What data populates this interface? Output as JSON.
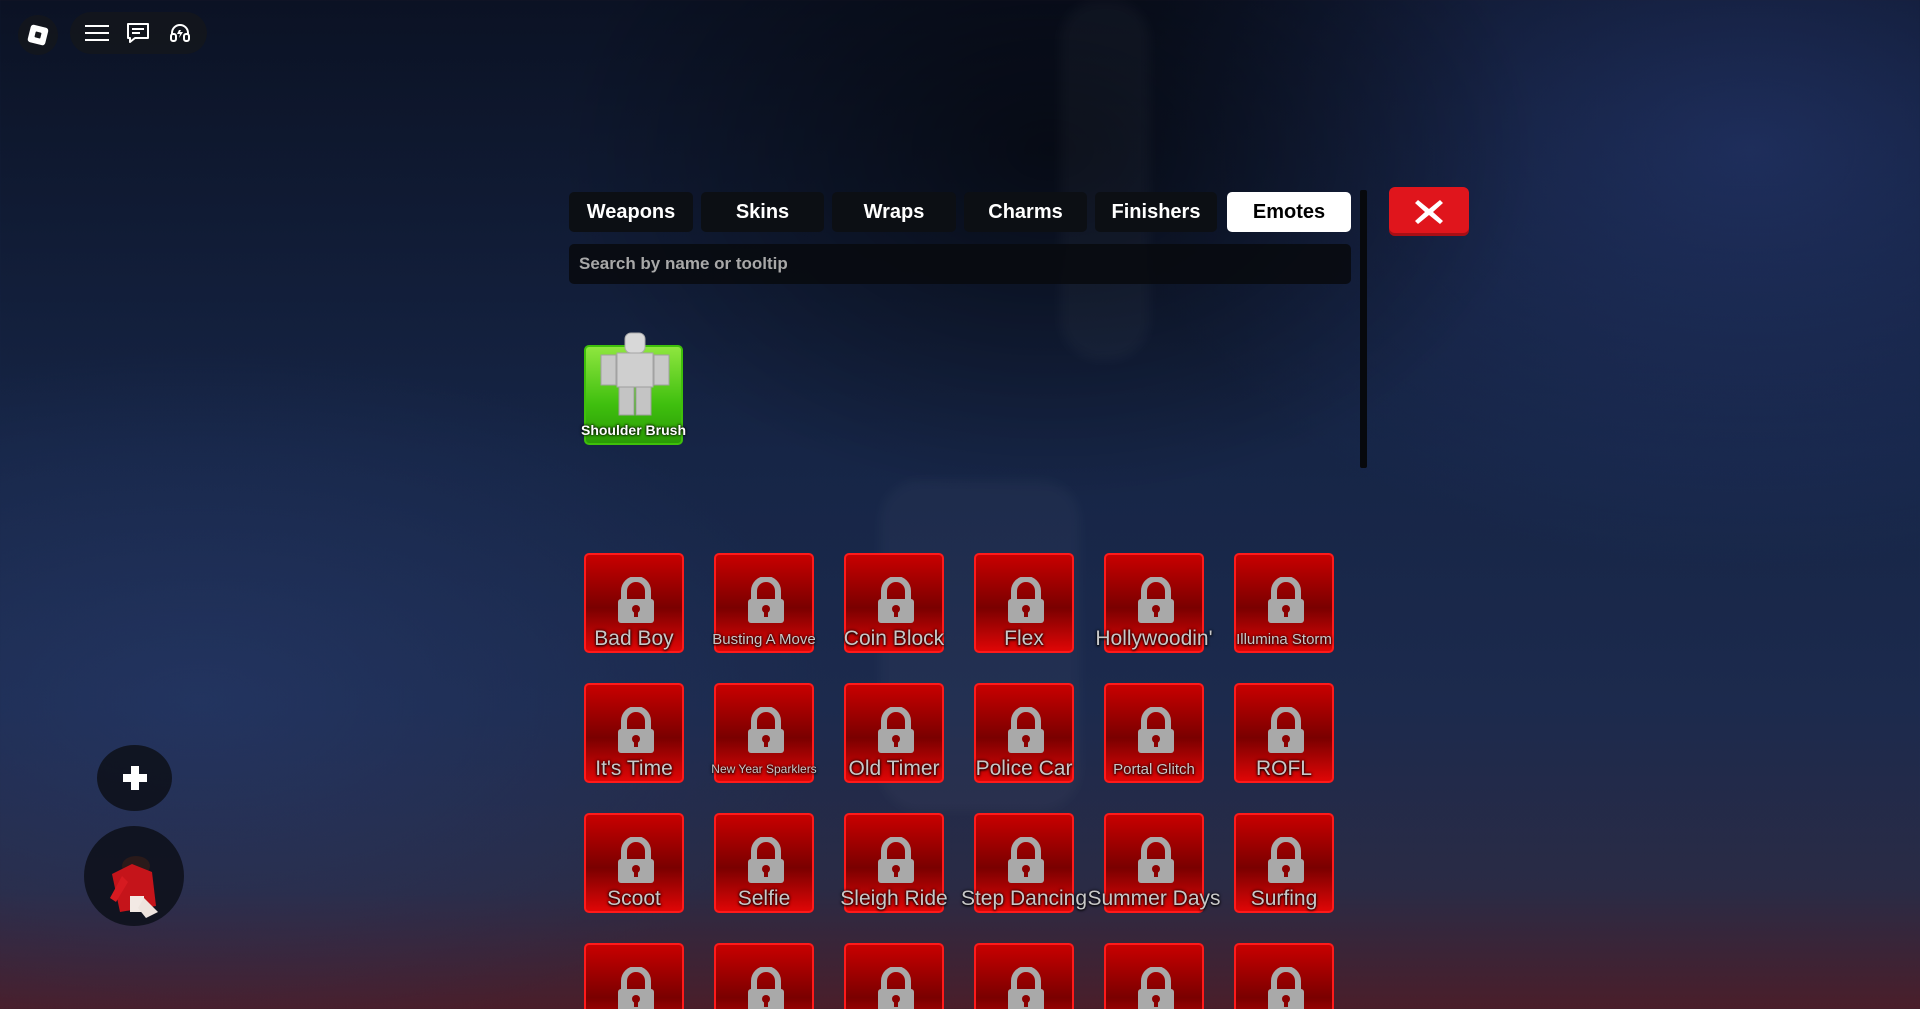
{
  "topbar": {
    "logo_icon": "roblox-logo-icon",
    "menu_icon": "hamburger-menu-icon",
    "chat_icon": "chat-icon",
    "headset_icon": "voice-headset-icon"
  },
  "tabs": [
    {
      "label": "Weapons",
      "active": false
    },
    {
      "label": "Skins",
      "active": false
    },
    {
      "label": "Wraps",
      "active": false
    },
    {
      "label": "Charms",
      "active": false
    },
    {
      "label": "Finishers",
      "active": false
    },
    {
      "label": "Emotes",
      "active": true
    }
  ],
  "close_icon": "close-x-icon",
  "search": {
    "placeholder": "Search by name or tooltip",
    "value": ""
  },
  "owned_emotes": [
    {
      "name": "Shoulder Brush",
      "color": "#3fbf0e"
    }
  ],
  "locked_emotes": [
    {
      "name": "Bad Boy"
    },
    {
      "name": "Busting A Move"
    },
    {
      "name": "Coin Block"
    },
    {
      "name": "Flex"
    },
    {
      "name": "Hollywoodin'"
    },
    {
      "name": "Illumina Storm"
    },
    {
      "name": "It's Time"
    },
    {
      "name": "New Year Sparklers"
    },
    {
      "name": "Old Timer"
    },
    {
      "name": "Police Car"
    },
    {
      "name": "Portal Glitch"
    },
    {
      "name": "ROFL"
    },
    {
      "name": "Scoot"
    },
    {
      "name": "Selfie"
    },
    {
      "name": "Sleigh Ride"
    },
    {
      "name": "Step Dancing"
    },
    {
      "name": "Summer Days"
    },
    {
      "name": "Surfing"
    },
    {
      "name": ""
    },
    {
      "name": ""
    },
    {
      "name": ""
    },
    {
      "name": ""
    },
    {
      "name": ""
    },
    {
      "name": ""
    }
  ],
  "colors": {
    "locked": "#c80000",
    "owned": "#3fbf0e",
    "close": "#e0151c"
  },
  "side_buttons": {
    "plus_icon": "plus-icon",
    "avatar_icon": "avatar-icon"
  }
}
